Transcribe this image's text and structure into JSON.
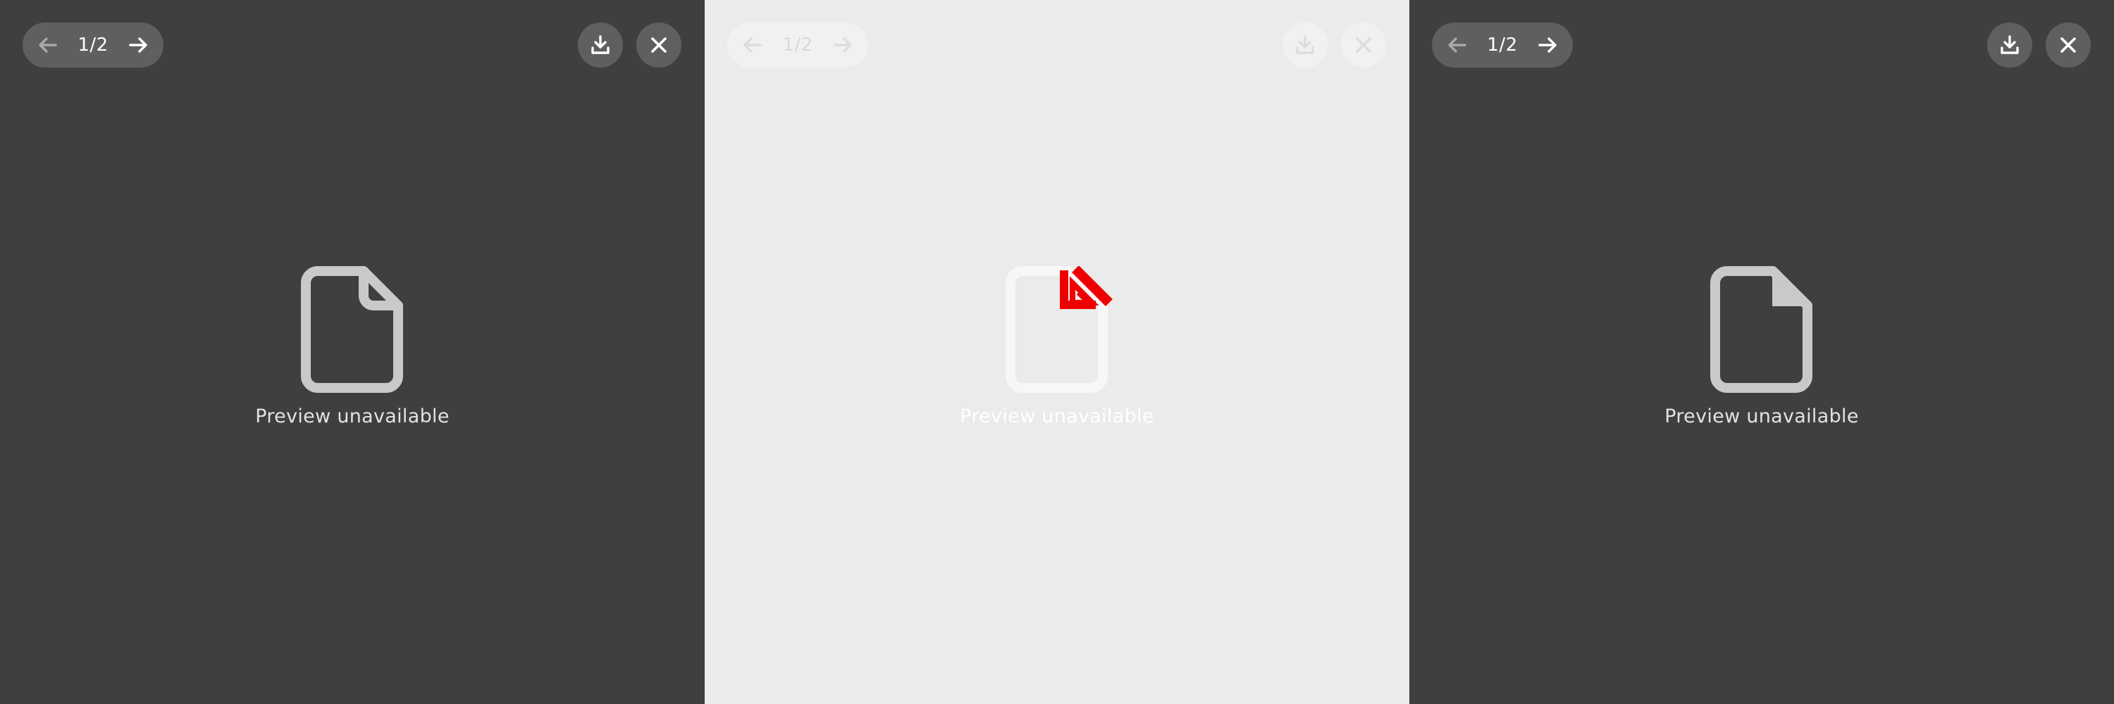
{
  "viewers": [
    {
      "theme": "dark",
      "page_counter": "1/2",
      "message": "Preview unavailable",
      "icons": {
        "prev": "arrow-left-icon",
        "next": "arrow-right-icon",
        "download": "download-icon",
        "close": "close-icon",
        "file": "file-icon"
      }
    },
    {
      "theme": "light",
      "page_counter": "1/2",
      "message": "Preview unavailable",
      "icons": {
        "prev": "arrow-left-icon",
        "next": "arrow-right-icon",
        "download": "download-icon",
        "close": "close-icon",
        "file": "file-icon",
        "overlay": "acrobat-pdf-icon"
      }
    },
    {
      "theme": "dark",
      "page_counter": "1/2",
      "message": "Preview unavailable",
      "icons": {
        "prev": "arrow-left-icon",
        "next": "arrow-right-icon",
        "download": "download-icon",
        "close": "close-icon",
        "file": "file-icon"
      }
    }
  ],
  "colors": {
    "dark_background": "#3f3f3f",
    "dark_control": "#5f5f5f",
    "light_background": "#ebebeb",
    "light_control": "#f1f1f1",
    "icon_gray": "#c8c8c8",
    "pdf_red": "#ee0000"
  }
}
